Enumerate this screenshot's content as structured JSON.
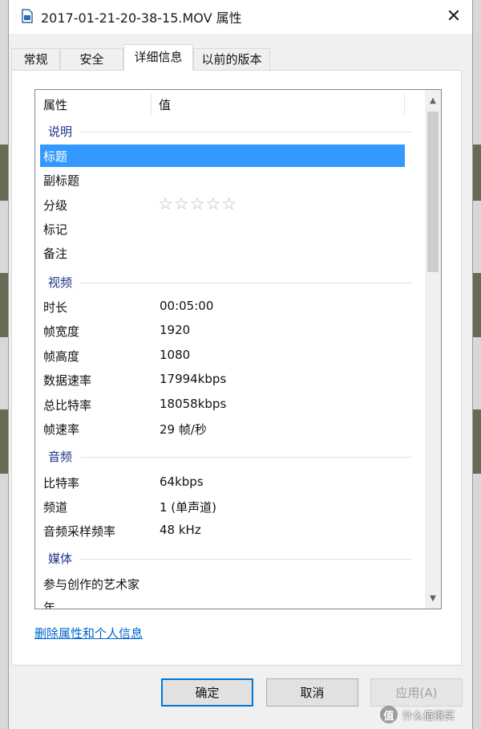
{
  "window": {
    "title": "2017-01-21-20-38-15.MOV 属性",
    "close_glyph": "✕"
  },
  "tabs": [
    {
      "label": "常规"
    },
    {
      "label": "安全"
    },
    {
      "label": "详细信息"
    },
    {
      "label": "以前的版本"
    }
  ],
  "active_tab": "详细信息",
  "columns": {
    "property": "属性",
    "value": "值"
  },
  "groups": {
    "description": {
      "label": "说明",
      "rows": [
        {
          "name": "标题",
          "value": ""
        },
        {
          "name": "副标题",
          "value": ""
        },
        {
          "name": "分级",
          "value": "",
          "rating": 0
        },
        {
          "name": "标记",
          "value": ""
        },
        {
          "name": "备注",
          "value": ""
        }
      ]
    },
    "video": {
      "label": "视频",
      "rows": [
        {
          "name": "时长",
          "value": "00:05:00"
        },
        {
          "name": "帧宽度",
          "value": "1920"
        },
        {
          "name": "帧高度",
          "value": "1080"
        },
        {
          "name": "数据速率",
          "value": "17994kbps"
        },
        {
          "name": "总比特率",
          "value": "18058kbps"
        },
        {
          "name": "帧速率",
          "value": "29 帧/秒"
        }
      ]
    },
    "audio": {
      "label": "音频",
      "rows": [
        {
          "name": "比特率",
          "value": "64kbps"
        },
        {
          "name": "频道",
          "value": "1 (单声道)"
        },
        {
          "name": "音频采样频率",
          "value": "48 kHz"
        }
      ]
    },
    "media": {
      "label": "媒体",
      "rows": [
        {
          "name": "参与创作的艺术家",
          "value": ""
        },
        {
          "name": "年",
          "value": ""
        }
      ]
    }
  },
  "selected_row": "标题",
  "stars_glyph": "☆☆☆☆☆",
  "remove_link": "删除属性和个人信息",
  "buttons": {
    "ok": "确定",
    "cancel": "取消",
    "apply": "应用(A)"
  },
  "watermark": {
    "badge": "值",
    "text": "什么值得买"
  },
  "colors": {
    "accent": "#3399ff",
    "group_text": "#1e3287",
    "link": "#0066cc",
    "default_border": "#0078d7"
  }
}
